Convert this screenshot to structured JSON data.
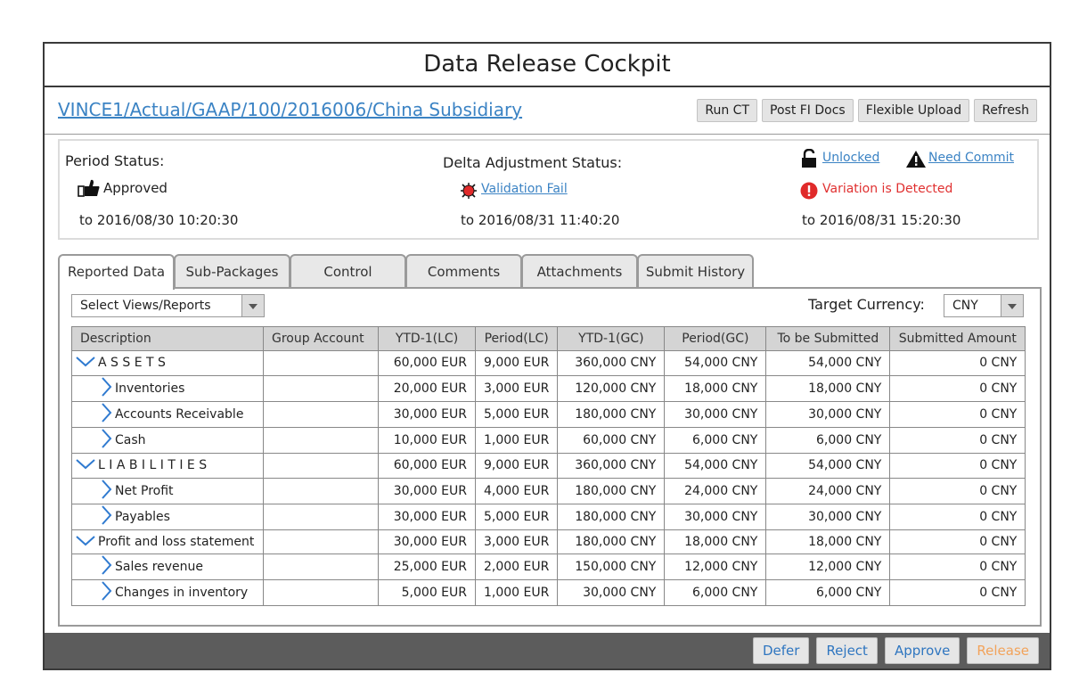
{
  "window": {
    "title": "Data Release Cockpit"
  },
  "header": {
    "path_link": "VINCE1/Actual/GAAP/100/2016006/China Subsidiary",
    "buttons": [
      "Run CT",
      "Post FI Docs",
      "Flexible Upload",
      "Refresh"
    ]
  },
  "status": {
    "period": {
      "label": "Period Status:",
      "value": "Approved",
      "time": "to 2016/08/30 10:20:30"
    },
    "delta": {
      "label": "Delta Adjustment Status:",
      "value": "Validation Fail",
      "time": "to 2016/08/31 11:40:20"
    },
    "lock": {
      "value": "Unlocked",
      "commit": "Need Commit",
      "variation": "Variation is Detected",
      "time": "to 2016/08/31 15:20:30"
    },
    "colors": {
      "link": "#3b83c4",
      "error": "#e03030"
    }
  },
  "tabs": [
    "Reported Data",
    "Sub-Packages",
    "Control",
    "Comments",
    "Attachments",
    "Submit History"
  ],
  "active_tab": "Reported Data",
  "filters": {
    "views_select": "Select Views/Reports",
    "target_currency_label": "Target Currency:",
    "target_currency_value": "CNY"
  },
  "table": {
    "columns": [
      "Description",
      "Group Account",
      "YTD-1(LC)",
      "Period(LC)",
      "YTD-1(GC)",
      "Period(GC)",
      "To be Submitted",
      "Submitted Amount"
    ],
    "rows": [
      {
        "desc": "A S S E T S",
        "level": 0,
        "group": "",
        "ytd_lc": "60,000 EUR",
        "period_lc": "9,000 EUR",
        "ytd_gc": "360,000 CNY",
        "period_gc": "54,000 CNY",
        "to_submit": "54,000 CNY",
        "submitted": "0 CNY"
      },
      {
        "desc": "Inventories",
        "level": 1,
        "group": "",
        "ytd_lc": "20,000 EUR",
        "period_lc": "3,000 EUR",
        "ytd_gc": "120,000 CNY",
        "period_gc": "18,000 CNY",
        "to_submit": "18,000 CNY",
        "submitted": "0 CNY"
      },
      {
        "desc": "Accounts Receivable",
        "level": 1,
        "group": "",
        "ytd_lc": "30,000 EUR",
        "period_lc": "5,000 EUR",
        "ytd_gc": "180,000 CNY",
        "period_gc": "30,000 CNY",
        "to_submit": "30,000 CNY",
        "submitted": "0 CNY"
      },
      {
        "desc": "Cash",
        "level": 1,
        "group": "",
        "ytd_lc": "10,000 EUR",
        "period_lc": "1,000 EUR",
        "ytd_gc": "60,000 CNY",
        "period_gc": "6,000 CNY",
        "to_submit": "6,000 CNY",
        "submitted": "0 CNY"
      },
      {
        "desc": "L I A B I L I T I E S",
        "level": 0,
        "group": "",
        "ytd_lc": "60,000 EUR",
        "period_lc": "9,000 EUR",
        "ytd_gc": "360,000 CNY",
        "period_gc": "54,000 CNY",
        "to_submit": "54,000 CNY",
        "submitted": "0 CNY"
      },
      {
        "desc": "Net Profit",
        "level": 1,
        "group": "",
        "ytd_lc": "30,000 EUR",
        "period_lc": "4,000 EUR",
        "ytd_gc": "180,000 CNY",
        "period_gc": "24,000 CNY",
        "to_submit": "24,000 CNY",
        "submitted": "0 CNY"
      },
      {
        "desc": "Payables",
        "level": 1,
        "group": "",
        "ytd_lc": "30,000 EUR",
        "period_lc": "5,000 EUR",
        "ytd_gc": "180,000 CNY",
        "period_gc": "30,000 CNY",
        "to_submit": "30,000 CNY",
        "submitted": "0 CNY"
      },
      {
        "desc": "Profit and loss statement",
        "level": 0,
        "group": "",
        "ytd_lc": "30,000 EUR",
        "period_lc": "3,000 EUR",
        "ytd_gc": "180,000 CNY",
        "period_gc": "18,000 CNY",
        "to_submit": "18,000 CNY",
        "submitted": "0 CNY"
      },
      {
        "desc": "Sales revenue",
        "level": 1,
        "group": "",
        "ytd_lc": "25,000 EUR",
        "period_lc": "2,000 EUR",
        "ytd_gc": "150,000 CNY",
        "period_gc": "12,000 CNY",
        "to_submit": "12,000 CNY",
        "submitted": "0 CNY"
      },
      {
        "desc": "Changes in inventory",
        "level": 1,
        "group": "",
        "ytd_lc": "5,000 EUR",
        "period_lc": "1,000 EUR",
        "ytd_gc": "30,000 CNY",
        "period_gc": "6,000 CNY",
        "to_submit": "6,000 CNY",
        "submitted": "0 CNY"
      }
    ]
  },
  "footer": {
    "buttons": [
      "Defer",
      "Reject",
      "Approve",
      "Release"
    ]
  }
}
